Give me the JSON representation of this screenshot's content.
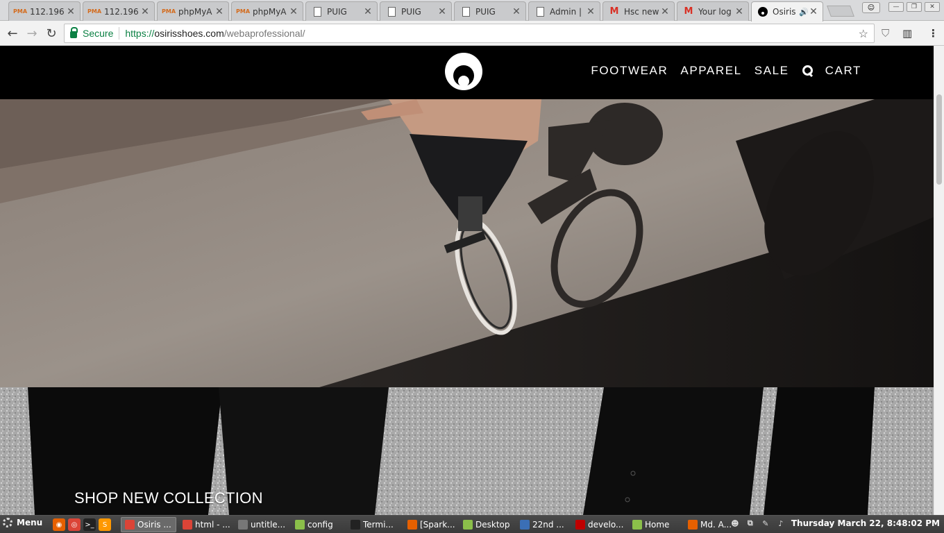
{
  "browser": {
    "tabs": [
      {
        "title": "112.196",
        "favicon": "phpmyadmin-icon",
        "favicon_text": "PMA"
      },
      {
        "title": "112.196",
        "favicon": "phpmyadmin-icon",
        "favicon_text": "PMA"
      },
      {
        "title": "phpMyA",
        "favicon": "phpmyadmin-icon",
        "favicon_text": "PMA"
      },
      {
        "title": "phpMyA",
        "favicon": "phpmyadmin-icon",
        "favicon_text": "PMA"
      },
      {
        "title": "PUIG",
        "favicon": "document-icon"
      },
      {
        "title": "PUIG",
        "favicon": "document-icon"
      },
      {
        "title": "PUIG",
        "favicon": "document-icon"
      },
      {
        "title": "Admin |",
        "favicon": "document-icon"
      },
      {
        "title": "Hsc new",
        "favicon": "gmail-icon",
        "favicon_text": "M"
      },
      {
        "title": "Your log",
        "favicon": "gmail-icon",
        "favicon_text": "M"
      },
      {
        "title": "Osiris",
        "favicon": "osiris-icon",
        "active": true,
        "audio": true
      }
    ],
    "close_glyph": "✕",
    "audio_glyph": "🔊",
    "window_controls": {
      "profile": "☺",
      "minimize": "—",
      "restore": "❐",
      "close": "✕"
    },
    "nav": {
      "back": "←",
      "forward": "→",
      "reload": "↻"
    },
    "secure_label": "Secure",
    "url": {
      "scheme": "https://",
      "host": "osirisshoes.com",
      "path": "/webaprofessional/"
    },
    "star_glyph": "☆",
    "extensions": {
      "shield": "⛉",
      "reader": "▥",
      "menu": "⋮"
    }
  },
  "site": {
    "nav_items": [
      "FOOTWEAR",
      "APPAREL",
      "SALE"
    ],
    "cart_label": "CART",
    "cta_label": "SHOP NEW COLLECTION"
  },
  "taskbar": {
    "menu_label": "Menu",
    "quick_launch": [
      {
        "name": "firefox-icon",
        "glyph": "◉",
        "color": "#e66000"
      },
      {
        "name": "chrome-icon",
        "glyph": "◎",
        "color": "#db4437"
      },
      {
        "name": "terminal-icon",
        "glyph": ">_",
        "color": "#222222"
      },
      {
        "name": "sublime-icon",
        "glyph": "S",
        "color": "#ff9800"
      }
    ],
    "windows": [
      {
        "label": "Osiris ...",
        "icon": "chrome-icon",
        "active": true
      },
      {
        "label": "html - ...",
        "icon": "chrome-icon"
      },
      {
        "label": "untitle...",
        "icon": "editor-icon"
      },
      {
        "label": "config",
        "icon": "folder-icon"
      },
      {
        "label": "Termi...",
        "icon": "terminal-icon"
      },
      {
        "label": "[Spark...",
        "icon": "firefox-icon"
      },
      {
        "label": "Desktop",
        "icon": "folder-icon"
      },
      {
        "label": "22nd ...",
        "icon": "document-icon"
      },
      {
        "label": "develo...",
        "icon": "filezilla-icon"
      },
      {
        "label": "Home",
        "icon": "folder-icon"
      },
      {
        "label": "Md. A...",
        "icon": "firefox-icon"
      }
    ],
    "clock": "Thursday March 22,  8:48:02 PM"
  },
  "colors": {
    "secure_green": "#0b8043",
    "header_bg": "#000000",
    "nav_text": "#ffffff"
  }
}
